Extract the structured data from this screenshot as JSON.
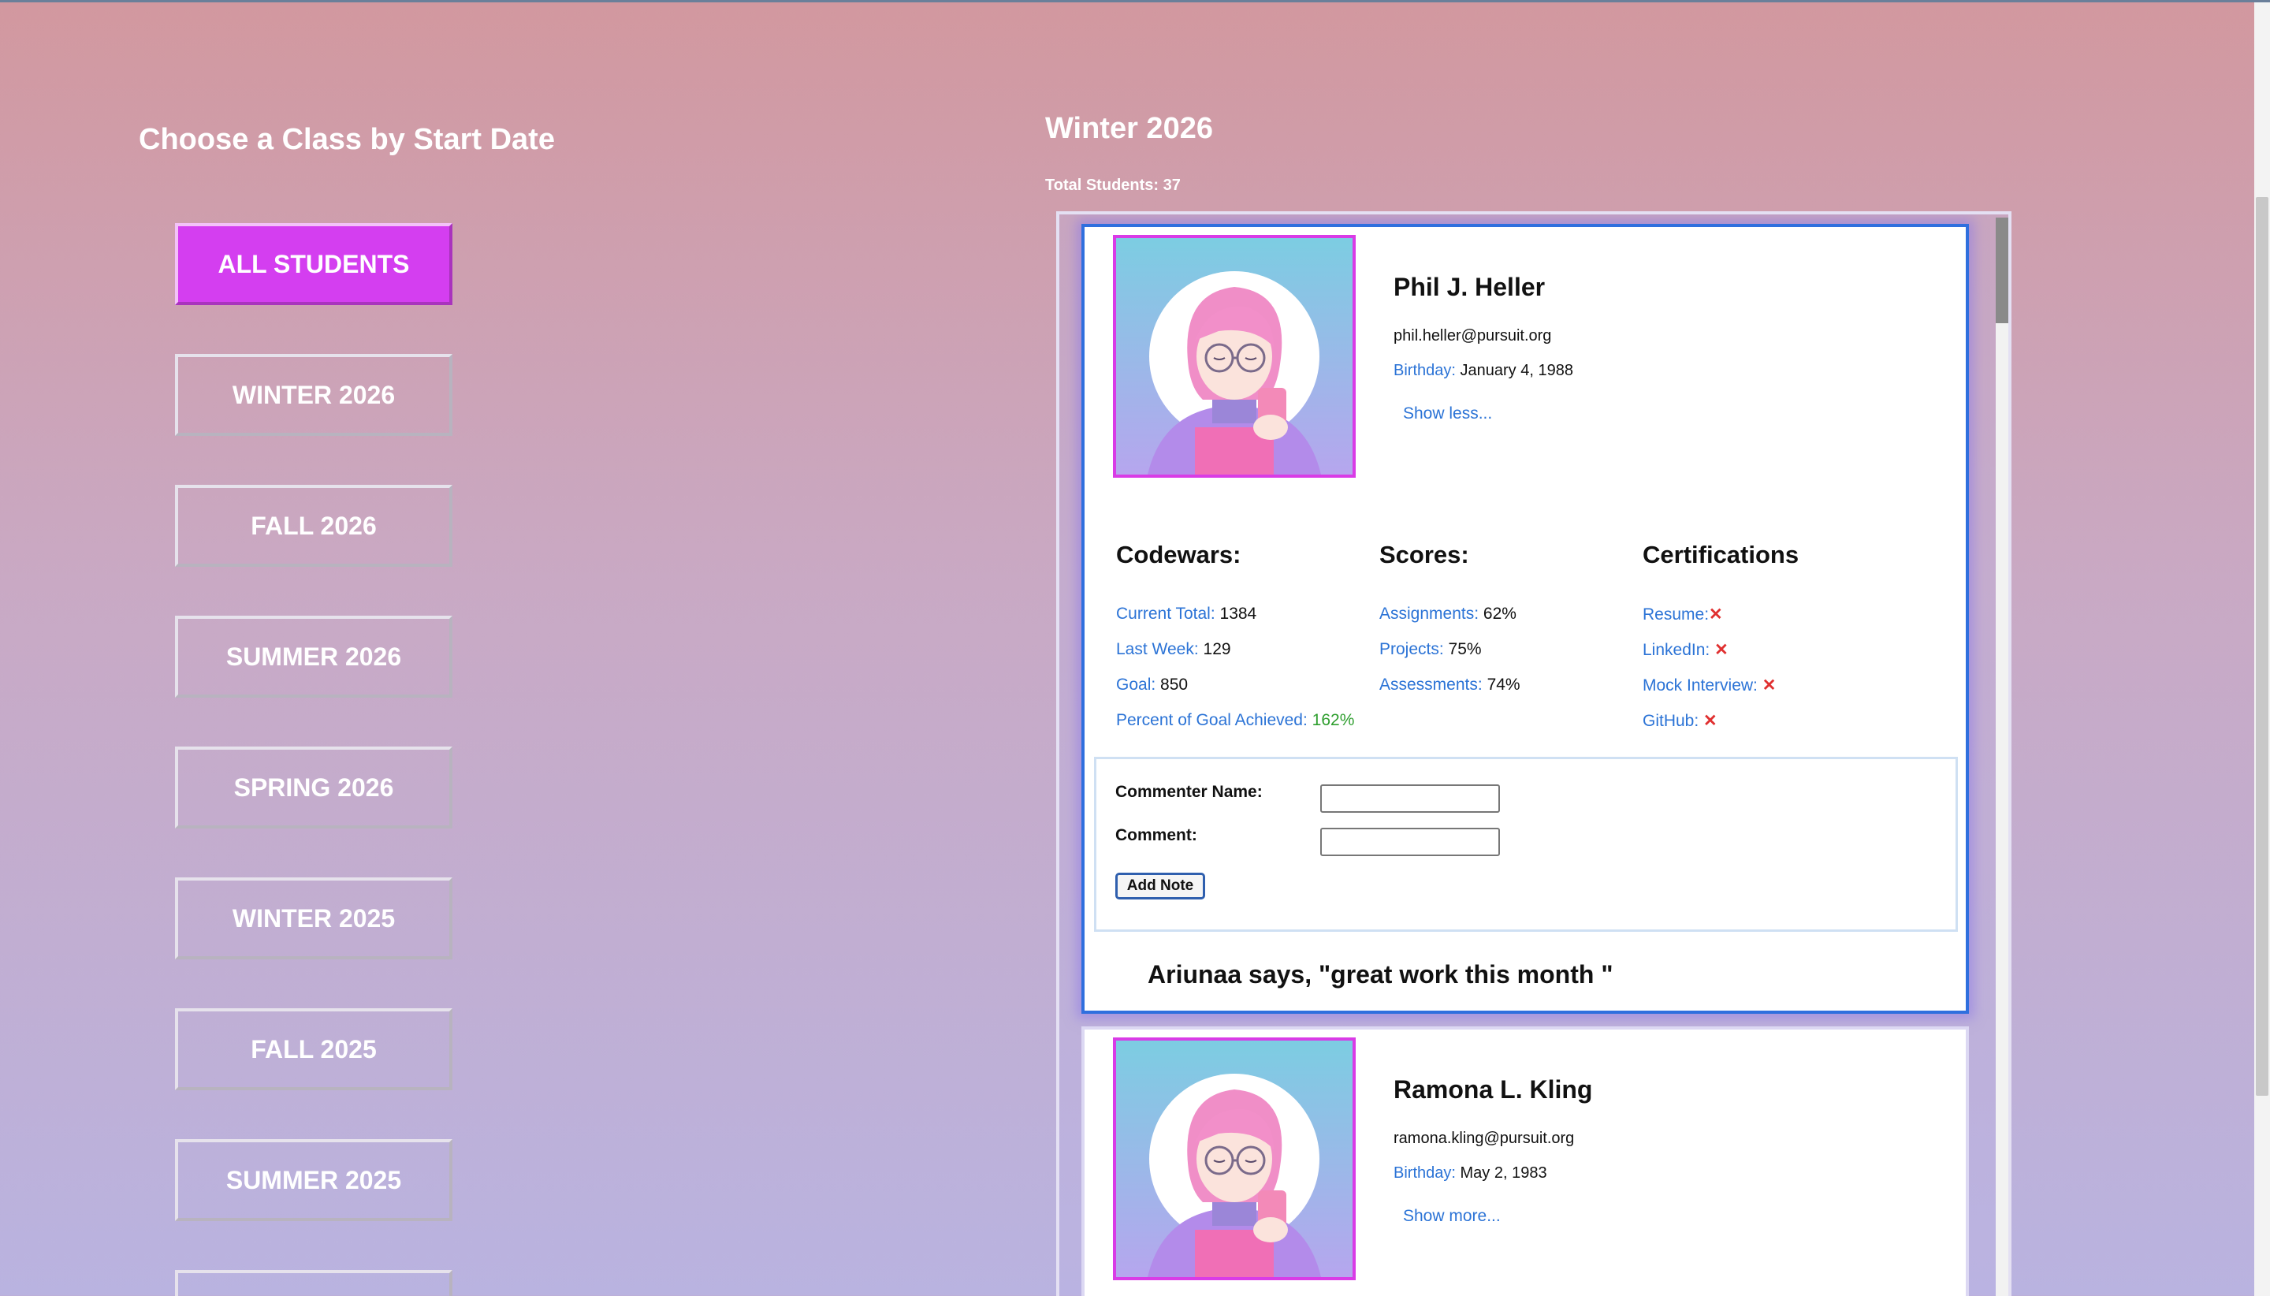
{
  "sidebar": {
    "title": "Choose a Class by Start Date",
    "classes": [
      {
        "label": "ALL STUDENTS",
        "active": true
      },
      {
        "label": "WINTER 2026"
      },
      {
        "label": "FALL 2026"
      },
      {
        "label": "SUMMER 2026"
      },
      {
        "label": "SPRING 2026"
      },
      {
        "label": "WINTER 2025"
      },
      {
        "label": "FALL 2025"
      },
      {
        "label": "SUMMER 2025"
      },
      {
        "label": ""
      }
    ]
  },
  "main": {
    "title": "Winter 2026",
    "total_students": "Total Students: 37"
  },
  "students": [
    {
      "name": "Phil J. Heller",
      "email": "phil.heller@pursuit.org",
      "birthday_label": "Birthday:",
      "birthday": "January 4, 1988",
      "toggle_label": "Show less...",
      "codewars": {
        "heading": "Codewars:",
        "current_total_label": "Current Total:",
        "current_total": "1384",
        "last_week_label": "Last Week:",
        "last_week": "129",
        "goal_label": "Goal:",
        "goal": "850",
        "percent_label": "Percent of Goal Achieved:",
        "percent": "162%"
      },
      "scores": {
        "heading": "Scores:",
        "assignments_label": "Assignments:",
        "assignments": "62%",
        "projects_label": "Projects:",
        "projects": "75%",
        "assessments_label": "Assessments:",
        "assessments": "74%"
      },
      "certifications": {
        "heading": "Certifications",
        "resume_label": "Resume:",
        "linkedin_label": "LinkedIn:",
        "mock_label": "Mock Interview:",
        "github_label": "GitHub:",
        "mark": "✕"
      },
      "note_form": {
        "name_label": "Commenter Name:",
        "name_value": "",
        "comment_label": "Comment:",
        "comment_value": "",
        "button_label": "Add Note"
      },
      "comment": "Ariunaa says, \"great work this month \""
    },
    {
      "name": "Ramona L. Kling",
      "email": "ramona.kling@pursuit.org",
      "birthday_label": "Birthday:",
      "birthday": "May 2, 1983",
      "toggle_label": "Show more..."
    }
  ],
  "colors": {
    "accent": "#d43ef0",
    "link": "#2b73d6",
    "success": "#2e9e2e",
    "error": "#e03030",
    "selected_border": "#2f6fde"
  },
  "icons": {
    "avatar": "avatar-illustration",
    "cross": "x-icon"
  }
}
